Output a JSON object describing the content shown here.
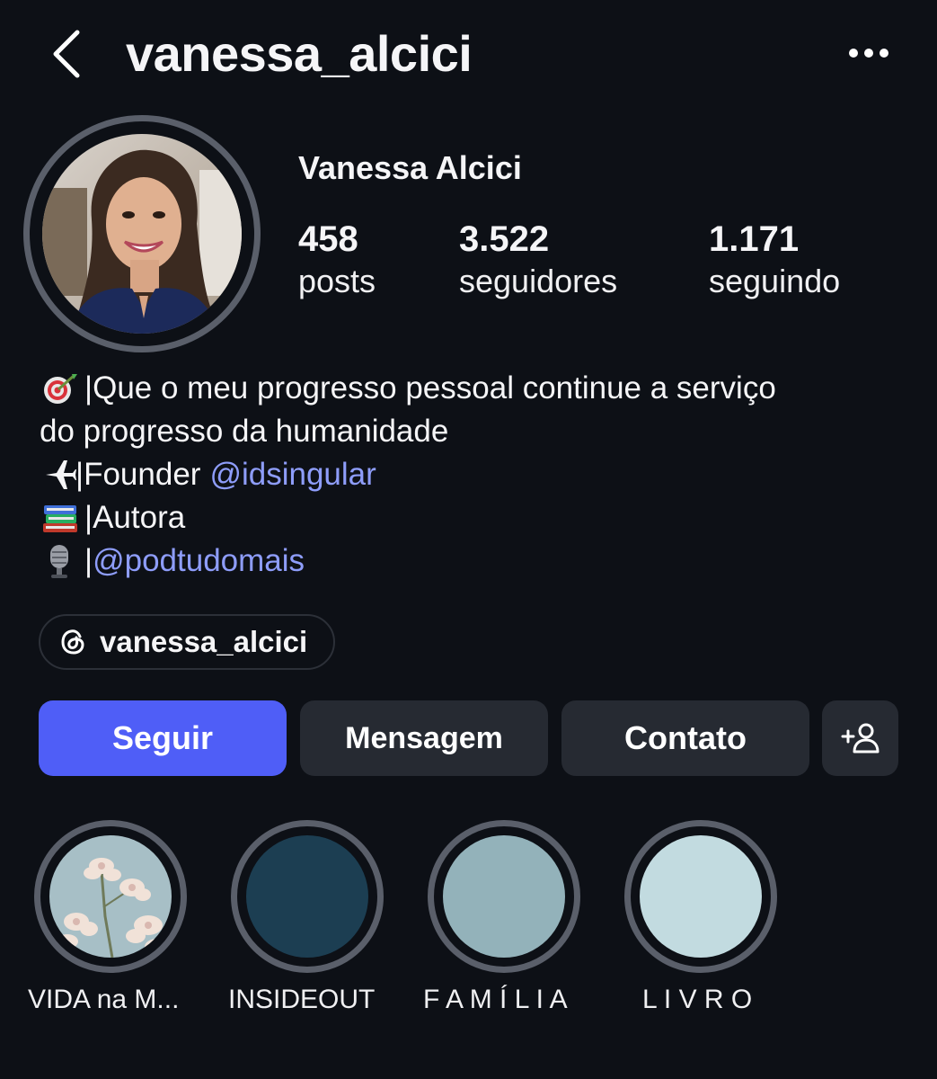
{
  "header": {
    "back_icon": "chevron-left-icon",
    "username": "vanessa_alcici",
    "more_icon": "more-horizontal-icon"
  },
  "profile": {
    "display_name": "Vanessa Alcici",
    "stats": {
      "posts": {
        "value": "458",
        "label": "posts"
      },
      "followers": {
        "value": "3.522",
        "label": "seguidores"
      },
      "following": {
        "value": "1.171",
        "label": "seguindo"
      }
    }
  },
  "bio": {
    "line1_emoji": "target-dart-icon",
    "line1_text": "|Que o meu progresso pessoal continue a serviço",
    "line2_text": "do progresso da humanidade",
    "line3_emoji": "airplane-icon",
    "line3_text": "|Founder ",
    "line3_mention": "@idsingular",
    "line4_emoji": "books-icon",
    "line4_text": "|Autora",
    "line5_emoji": "microphone-icon",
    "line5_text": "|",
    "line5_mention": "@podtudomais",
    "mention_color": "#8e9dfa"
  },
  "threads": {
    "icon": "threads-icon",
    "handle": "vanessa_alcici"
  },
  "actions": {
    "follow_label": "Seguir",
    "message_label": "Mensagem",
    "contact_label": "Contato",
    "add_user_icon": "add-user-icon",
    "follow_color": "#4f5ef7",
    "secondary_color": "#262a32"
  },
  "highlights": [
    {
      "label": "VIDA na M...",
      "cover": "flowers-photo"
    },
    {
      "label": "INSIDEOUT",
      "cover_color": "#1c3e52"
    },
    {
      "label": "F A M Í L I A",
      "cover_color": "#93b2ba"
    },
    {
      "label": "L I V R O",
      "cover_color": "#c2dbe0"
    }
  ],
  "colors": {
    "background": "#0d1016",
    "ring": "#5a5f6a"
  }
}
